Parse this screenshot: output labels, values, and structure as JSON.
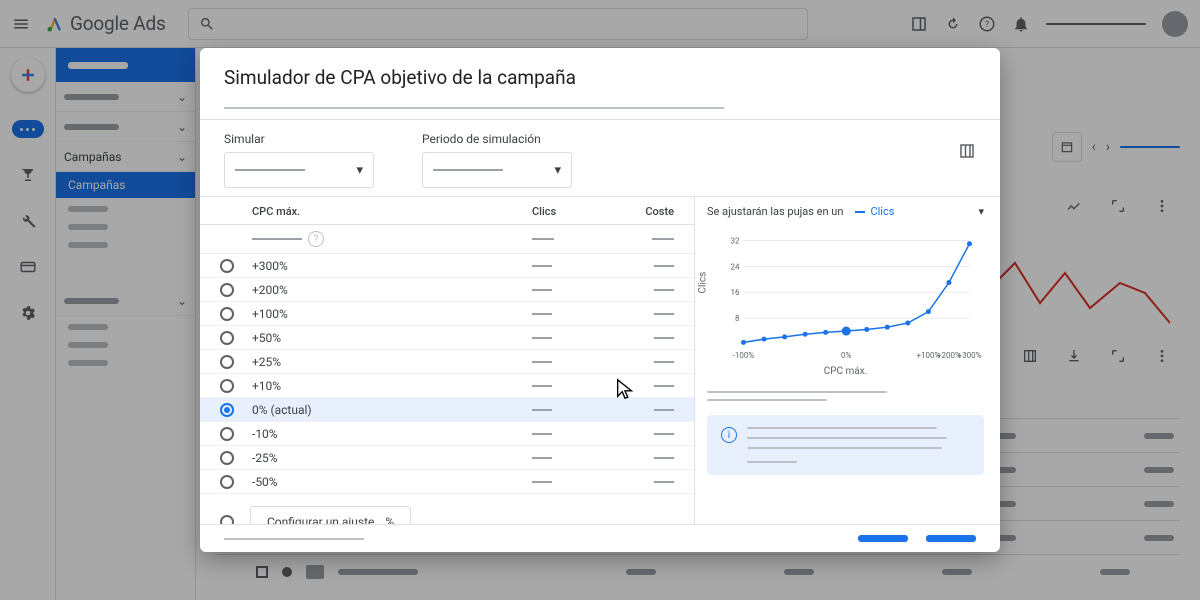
{
  "header": {
    "product": "Google Ads"
  },
  "sidebar": {
    "section": "Campañas",
    "active": "Campañas"
  },
  "modal": {
    "title": "Simulador de CPA objetivo de la campaña",
    "simulate_label": "Simular",
    "period_label": "Periodo de simulación",
    "col_cpc": "CPC máx.",
    "col_clicks": "Clics",
    "col_cost": "Coste",
    "rows": [
      {
        "label": "+300%",
        "selected": false
      },
      {
        "label": "+200%",
        "selected": false
      },
      {
        "label": "+100%",
        "selected": false
      },
      {
        "label": "+50%",
        "selected": false
      },
      {
        "label": "+25%",
        "selected": false
      },
      {
        "label": "+10%",
        "selected": false
      },
      {
        "label": "0% (actual)",
        "selected": true
      },
      {
        "label": "-10%",
        "selected": false
      },
      {
        "label": "-25%",
        "selected": false
      },
      {
        "label": "-50%",
        "selected": false
      }
    ],
    "custom_button": "Configurar un ajuste… %",
    "right_intro": "Se ajustarán las pujas en un",
    "metric_selected": "Clics",
    "chart_xlabel": "CPC máx.",
    "chart_ylabel": "Clics"
  },
  "chart_data": {
    "type": "line",
    "xlabel": "CPC máx.",
    "ylabel": "Clics",
    "x_ticks": [
      "-100%",
      "0%",
      "+100%",
      "+200%",
      "+300%"
    ],
    "y_ticks": [
      8,
      16,
      24,
      32
    ],
    "points": [
      {
        "x": "-100%",
        "y": 0.5
      },
      {
        "x": "-75%",
        "y": 1.5
      },
      {
        "x": "-50%",
        "y": 2.2
      },
      {
        "x": "-25%",
        "y": 3
      },
      {
        "x": "-10%",
        "y": 3.6
      },
      {
        "x": "0%",
        "y": 4
      },
      {
        "x": "+10%",
        "y": 4.5
      },
      {
        "x": "+25%",
        "y": 5.2
      },
      {
        "x": "+50%",
        "y": 6.5
      },
      {
        "x": "+100%",
        "y": 10
      },
      {
        "x": "+200%",
        "y": 19
      },
      {
        "x": "+300%",
        "y": 31
      }
    ],
    "selected_x": "0%",
    "ylim": [
      0,
      34
    ]
  }
}
